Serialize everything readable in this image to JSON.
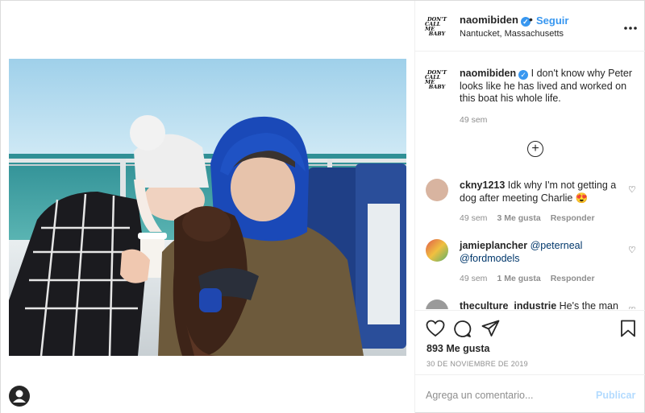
{
  "header": {
    "avatar_text": [
      "DON'T",
      "CALL ME",
      "BABY"
    ],
    "username": "naomibiden",
    "verified_mark": "✓",
    "dot": "•",
    "follow_label": "Seguir",
    "location": "Nantucket, Massachusetts",
    "more_icon": "more-options-icon"
  },
  "caption": {
    "username": "naomibiden",
    "text": "I don't know why Peter looks like he has lived and worked on this boat his whole life.",
    "time": "49 sem"
  },
  "load_more_icon": "plus-circle-icon",
  "comments": [
    {
      "username": "ckny1213",
      "text": "Idk why I'm not getting a dog after meeting Charlie 😍",
      "time": "49 sem",
      "likes": "3 Me gusta",
      "reply": "Responder",
      "avatar_color": "#d8b4a0"
    },
    {
      "username": "jamieplancher",
      "mention1": "@peterneal",
      "mention2": "@fordmodels",
      "time": "49 sem",
      "likes": "1 Me gusta",
      "reply": "Responder",
      "avatar_color": "#c9a23a"
    },
    {
      "username": "theculture_industrie",
      "text": "He's the man",
      "avatar_color": "#9a9a9a"
    }
  ],
  "actions": {
    "like_icon": "heart-icon",
    "comment_icon": "comment-icon",
    "share_icon": "paper-plane-icon",
    "save_icon": "bookmark-icon",
    "likes_count": "893 Me gusta",
    "date": "30 DE NOVIEMBRE DE 2019"
  },
  "comment_box": {
    "placeholder": "Agrega un comentario...",
    "publish_label": "Publicar"
  },
  "colors": {
    "accent": "#3897f0",
    "muted": "#8e8e8e",
    "publish_disabled": "#b3dbff"
  }
}
